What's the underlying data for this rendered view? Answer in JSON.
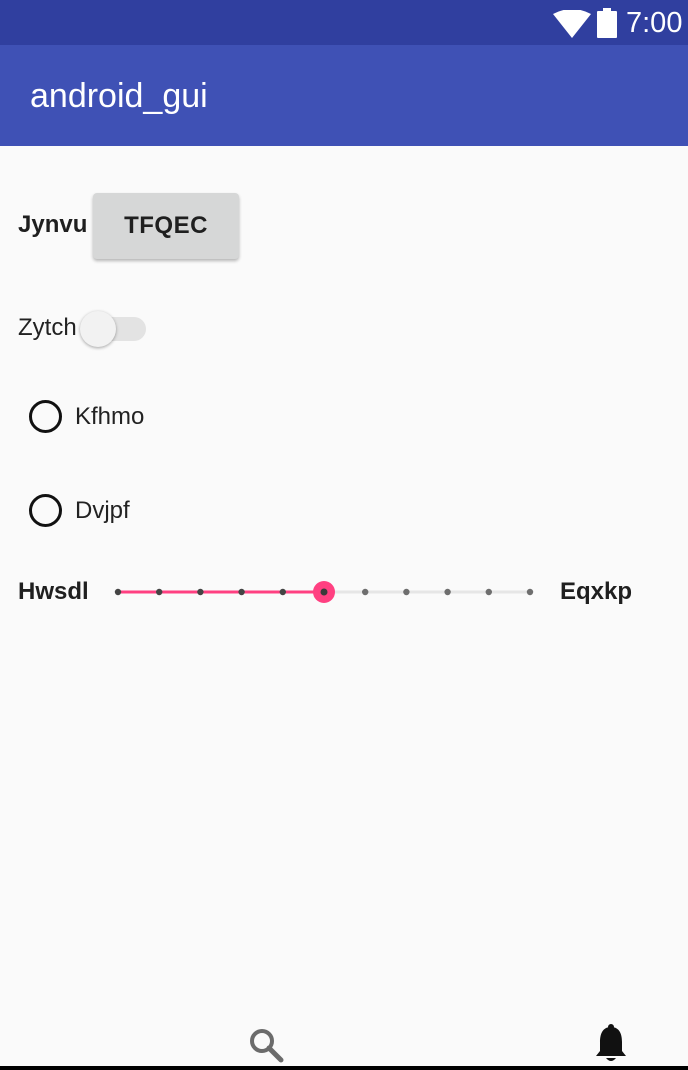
{
  "status_bar": {
    "time": "7:00",
    "icons": [
      "wifi-icon",
      "battery-icon"
    ],
    "background": "#303f9f"
  },
  "app_bar": {
    "title": "android_gui",
    "background": "#3f51b5"
  },
  "form": {
    "button_row": {
      "label": "Jynvu",
      "button_label": "TFQEC"
    },
    "switch_row": {
      "label": "Zytch",
      "checked": false
    },
    "radios": [
      {
        "label": "Kfhmo",
        "checked": false
      },
      {
        "label": "Dvjpf",
        "checked": false
      }
    ],
    "slider": {
      "min_label": "Hwsdl",
      "max_label": "Eqxkp",
      "value": 5,
      "steps": 10,
      "accent": "#ff4081"
    }
  },
  "bottom_nav": {
    "items": [
      "search-icon",
      "bell-icon"
    ]
  }
}
